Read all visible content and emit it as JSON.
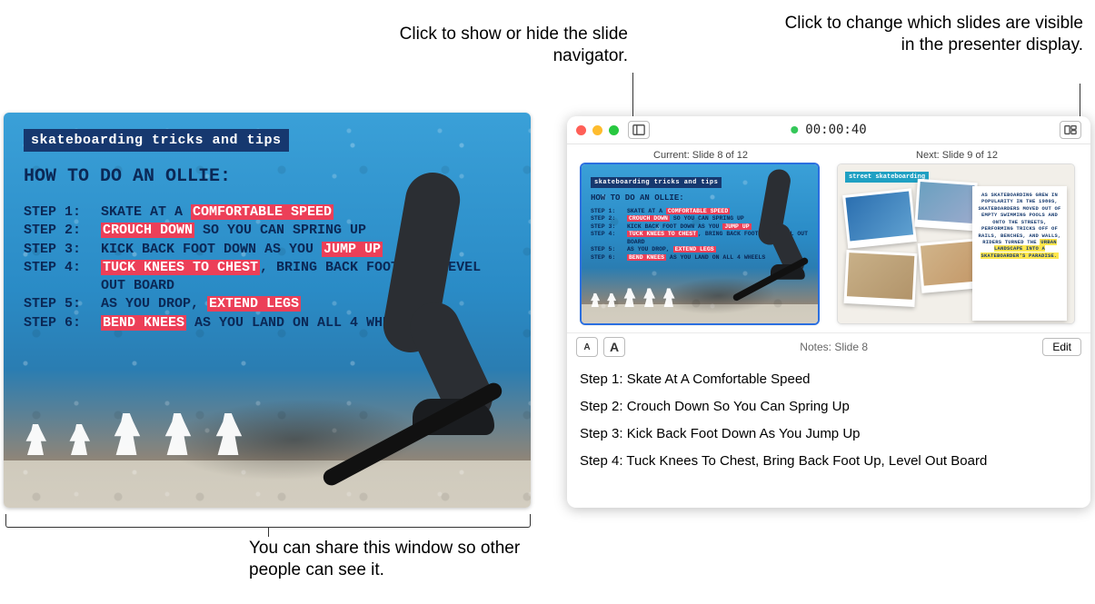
{
  "annotations": {
    "navigator": "Click to show or hide the slide navigator.",
    "layout": "Click to change which slides are visible in the presenter display.",
    "share": "You can share this window so other people can see it."
  },
  "slide": {
    "badge": "skateboarding tricks and tips",
    "title": "HOW TO DO AN OLLIE:",
    "label1": "STEP 1:",
    "label2": "STEP 2:",
    "label3": "STEP 3:",
    "label4": "STEP 4:",
    "label5": "STEP 5:",
    "label6": "STEP 6:",
    "s1a": "SKATE AT A ",
    "s1b": "COMFORTABLE SPEED",
    "s2a": "CROUCH DOWN",
    "s2b": " SO YOU CAN SPRING UP",
    "s3a": "KICK BACK FOOT DOWN AS YOU ",
    "s3b": "JUMP UP",
    "s4a": "TUCK KNEES TO CHEST",
    "s4b": ", BRING BACK FOOT UP, LEVEL OUT BOARD",
    "s5a": "AS YOU DROP, ",
    "s5b": "EXTEND LEGS",
    "s6a": "BEND KNEES",
    "s6b": " AS YOU LAND ON ALL 4 WHEELS"
  },
  "presenter": {
    "timer": "00:00:40",
    "current_label": "Current: Slide 8 of 12",
    "next_label": "Next: Slide 9 of 12",
    "notes_label": "Notes: Slide 8",
    "edit": "Edit",
    "font_small": "A",
    "font_big": "A",
    "notes": {
      "n1": "Step 1: Skate At A Comfortable Speed",
      "n2": "Step 2: Crouch Down So You Can Spring Up",
      "n3": "Step 3: Kick Back Foot Down As You Jump Up",
      "n4": "Step 4: Tuck Knees To Chest, Bring Back Foot Up, Level Out Board"
    }
  },
  "next_slide": {
    "badge": "street skateboarding",
    "card": "AS SKATEBOARDING GREW IN POPULARITY IN THE 1980S, SKATEBOARDERS MOVED OUT OF EMPTY SWIMMING POOLS AND ONTO THE STREETS, PERFORMING TRICKS OFF OF RAILS, BENCHES, AND WALLS, RIDERS TURNED THE ",
    "card_hl": "URBAN LANDSCAPE INTO A SKATEBOARDER'S PARADISE."
  }
}
